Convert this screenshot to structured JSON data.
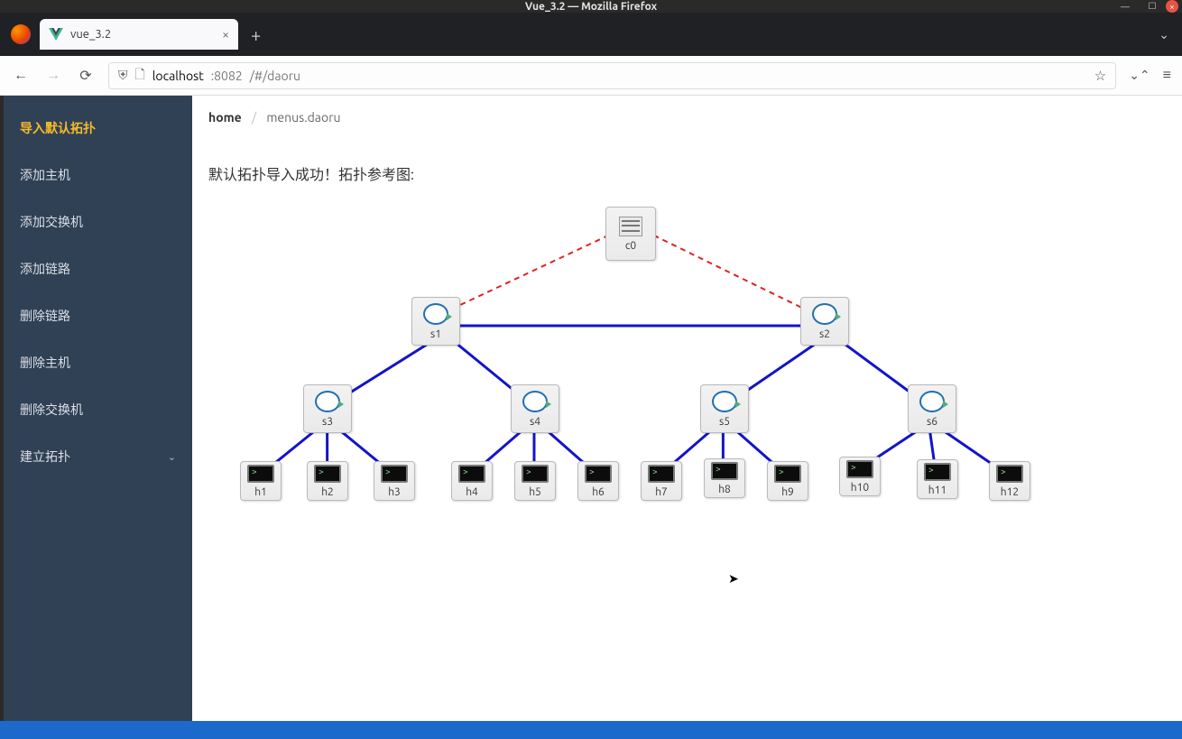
{
  "window": {
    "title": "Vue_3.2 — Mozilla Firefox"
  },
  "tab": {
    "title": "vue_3.2"
  },
  "url": {
    "host": "localhost",
    "port": ":8082",
    "path": "/#/daoru"
  },
  "sidebar": {
    "items": [
      {
        "label": "导入默认拓扑",
        "active": true
      },
      {
        "label": "添加主机"
      },
      {
        "label": "添加交换机"
      },
      {
        "label": "添加链路"
      },
      {
        "label": "删除链路"
      },
      {
        "label": "删除主机"
      },
      {
        "label": "删除交换机"
      },
      {
        "label": "建立拓扑",
        "caret": true
      }
    ]
  },
  "breadcrumb": {
    "root": "home",
    "current": "menus.daoru"
  },
  "status": "默认拓扑导入成功！拓扑参考图:",
  "topo": {
    "controller": {
      "id": "c0"
    },
    "switches": [
      "s1",
      "s2",
      "s3",
      "s4",
      "s5",
      "s6"
    ],
    "hosts": [
      "h1",
      "h2",
      "h3",
      "h4",
      "h5",
      "h6",
      "h7",
      "h8",
      "h9",
      "h10",
      "h11",
      "h12"
    ]
  },
  "chart_data": {
    "type": "diagram",
    "title": "默认拓扑导入成功！拓扑参考图:",
    "nodes": [
      {
        "id": "c0",
        "type": "controller"
      },
      {
        "id": "s1",
        "type": "switch"
      },
      {
        "id": "s2",
        "type": "switch"
      },
      {
        "id": "s3",
        "type": "switch"
      },
      {
        "id": "s4",
        "type": "switch"
      },
      {
        "id": "s5",
        "type": "switch"
      },
      {
        "id": "s6",
        "type": "switch"
      },
      {
        "id": "h1",
        "type": "host"
      },
      {
        "id": "h2",
        "type": "host"
      },
      {
        "id": "h3",
        "type": "host"
      },
      {
        "id": "h4",
        "type": "host"
      },
      {
        "id": "h5",
        "type": "host"
      },
      {
        "id": "h6",
        "type": "host"
      },
      {
        "id": "h7",
        "type": "host"
      },
      {
        "id": "h8",
        "type": "host"
      },
      {
        "id": "h9",
        "type": "host"
      },
      {
        "id": "h10",
        "type": "host"
      },
      {
        "id": "h11",
        "type": "host"
      },
      {
        "id": "h12",
        "type": "host"
      }
    ],
    "edges": [
      {
        "from": "c0",
        "to": "s1",
        "style": "control"
      },
      {
        "from": "c0",
        "to": "s2",
        "style": "control"
      },
      {
        "from": "s1",
        "to": "s2",
        "style": "data"
      },
      {
        "from": "s1",
        "to": "s3",
        "style": "data"
      },
      {
        "from": "s1",
        "to": "s4",
        "style": "data"
      },
      {
        "from": "s2",
        "to": "s5",
        "style": "data"
      },
      {
        "from": "s2",
        "to": "s6",
        "style": "data"
      },
      {
        "from": "s3",
        "to": "h1",
        "style": "data"
      },
      {
        "from": "s3",
        "to": "h2",
        "style": "data"
      },
      {
        "from": "s3",
        "to": "h3",
        "style": "data"
      },
      {
        "from": "s4",
        "to": "h4",
        "style": "data"
      },
      {
        "from": "s4",
        "to": "h5",
        "style": "data"
      },
      {
        "from": "s4",
        "to": "h6",
        "style": "data"
      },
      {
        "from": "s5",
        "to": "h7",
        "style": "data"
      },
      {
        "from": "s5",
        "to": "h8",
        "style": "data"
      },
      {
        "from": "s5",
        "to": "h9",
        "style": "data"
      },
      {
        "from": "s6",
        "to": "h10",
        "style": "data"
      },
      {
        "from": "s6",
        "to": "h11",
        "style": "data"
      },
      {
        "from": "s6",
        "to": "h12",
        "style": "data"
      }
    ],
    "legend": {
      "control": "dashed-red",
      "data": "solid-blue"
    }
  }
}
